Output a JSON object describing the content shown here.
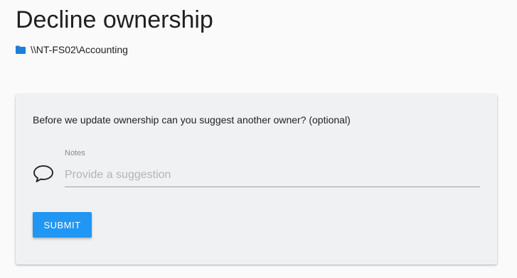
{
  "page": {
    "title": "Decline ownership",
    "path": "\\\\NT-FS02\\Accounting",
    "path_icon": "folder-icon"
  },
  "card": {
    "question": "Before we update ownership can you suggest another owner? (optional)",
    "notes": {
      "label": "Notes",
      "placeholder": "Provide a suggestion",
      "value": "",
      "icon": "comment-icon"
    },
    "submit_label": "SUBMIT"
  },
  "colors": {
    "accent": "#2196f3",
    "folder": "#1e7fd8",
    "card_background": "#f0f1f3",
    "page_background": "#fafafa"
  }
}
